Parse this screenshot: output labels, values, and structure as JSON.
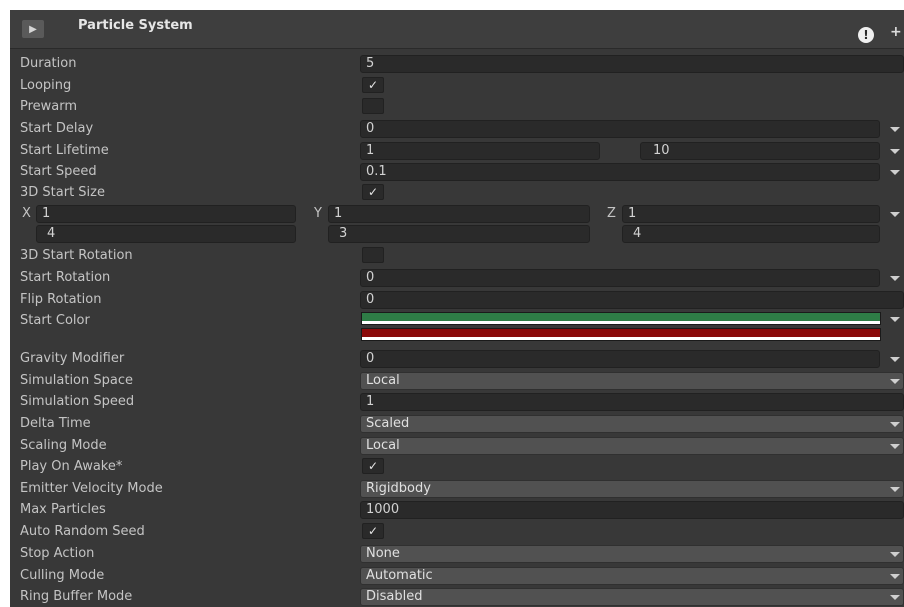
{
  "header": {
    "title": "Particle System",
    "icon": "particle-icon",
    "info_glyph": "!",
    "plus_glyph": "+"
  },
  "check_glyph": "✓",
  "labels": {
    "duration": "Duration",
    "looping": "Looping",
    "prewarm": "Prewarm",
    "start_delay": "Start Delay",
    "start_lifetime": "Start Lifetime",
    "start_speed": "Start Speed",
    "start_size_3d": "3D Start Size",
    "start_rotation_3d": "3D Start Rotation",
    "start_rotation": "Start Rotation",
    "flip_rotation": "Flip Rotation",
    "start_color": "Start Color",
    "gravity_modifier": "Gravity Modifier",
    "simulation_space": "Simulation Space",
    "simulation_speed": "Simulation Speed",
    "delta_time": "Delta Time",
    "scaling_mode": "Scaling Mode",
    "play_on_awake": "Play On Awake*",
    "emitter_velocity_mode": "Emitter Velocity Mode",
    "max_particles": "Max Particles",
    "auto_random_seed": "Auto Random Seed",
    "stop_action": "Stop Action",
    "culling_mode": "Culling Mode",
    "ring_buffer_mode": "Ring Buffer Mode"
  },
  "values": {
    "duration": "5",
    "looping": true,
    "prewarm": false,
    "start_delay": "0",
    "start_lifetime_min": "1",
    "start_lifetime_max": "10",
    "start_speed": "0.1",
    "start_size_3d": true,
    "size": {
      "x_label": "X",
      "y_label": "Y",
      "z_label": "Z",
      "x_min": "1",
      "x_max": "4",
      "y_min": "1",
      "y_max": "3",
      "z_min": "1",
      "z_max": "4"
    },
    "start_rotation_3d": false,
    "start_rotation": "0",
    "flip_rotation": "0",
    "start_color_a": "#2e7d46",
    "start_color_b": "#8b0a0a",
    "gravity_modifier": "0",
    "simulation_space": "Local",
    "simulation_speed": "1",
    "delta_time": "Scaled",
    "scaling_mode": "Local",
    "play_on_awake": true,
    "emitter_velocity_mode": "Rigidbody",
    "max_particles": "1000",
    "auto_random_seed": true,
    "stop_action": "None",
    "culling_mode": "Automatic",
    "ring_buffer_mode": "Disabled"
  }
}
